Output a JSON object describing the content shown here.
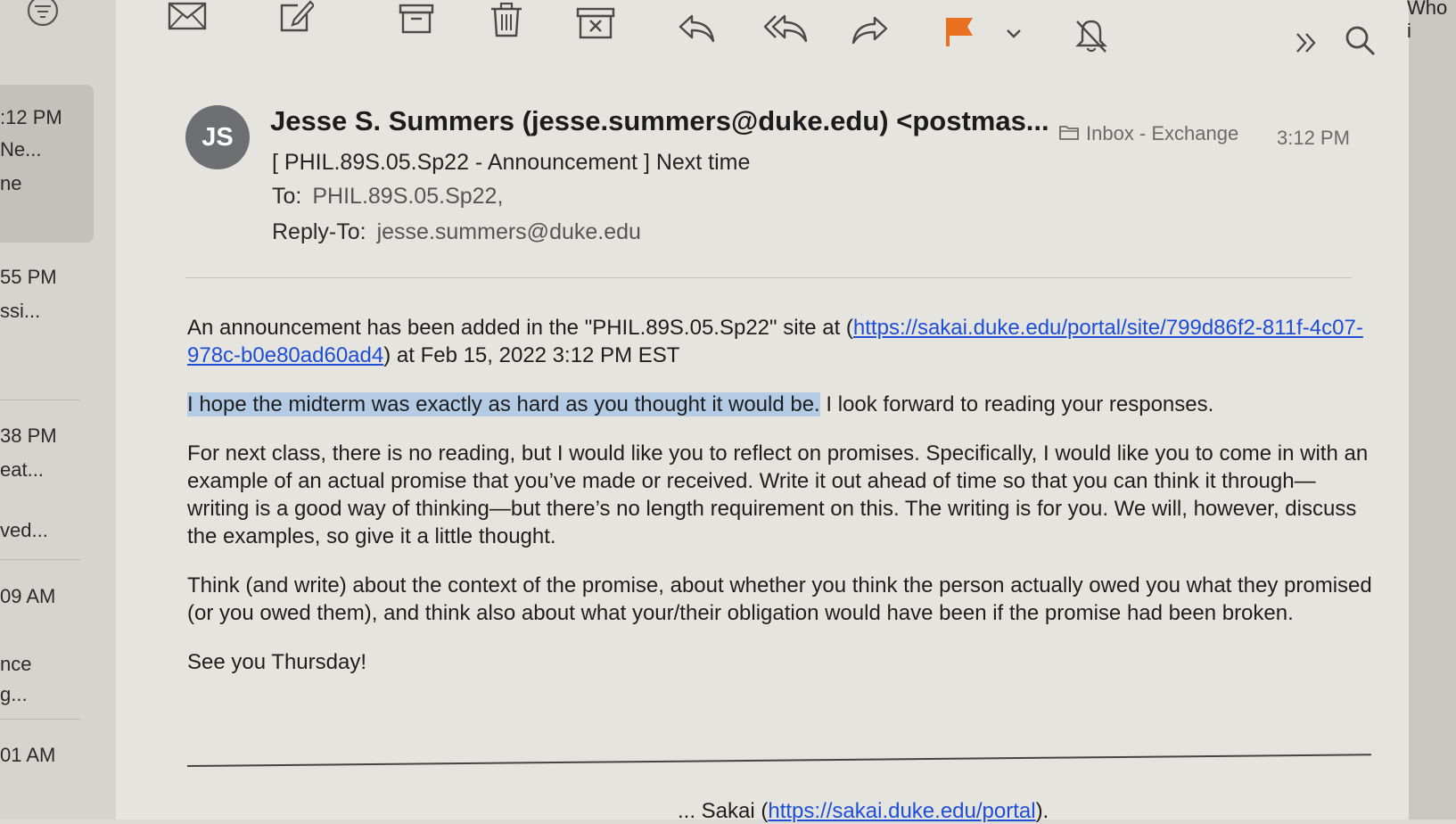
{
  "toolbar": {
    "icons": [
      "filter-icon",
      "mail-icon",
      "compose-icon",
      "archive-icon",
      "trash-icon",
      "junk-icon",
      "reply-icon",
      "reply-all-icon",
      "forward-icon",
      "flag-icon",
      "chevron-down-icon",
      "mute-icon",
      "more-icon",
      "search-icon"
    ],
    "flag_color": "#e8701f"
  },
  "sidebar": {
    "items": [
      {
        "time": ":12 PM",
        "lines": [
          "Ne...",
          "ne"
        ],
        "selected": true
      },
      {
        "time": "55 PM",
        "lines": [
          "ssi..."
        ]
      },
      {
        "time": "38 PM",
        "lines": [
          "eat...",
          "ved..."
        ]
      },
      {
        "time": "09 AM",
        "lines": [
          "nce",
          "g..."
        ]
      },
      {
        "time": "01 AM",
        "lines": []
      }
    ]
  },
  "right_edge_text": "Who i",
  "message": {
    "avatar_initials": "JS",
    "from": "Jesse S. Summers (jesse.summers@duke.edu) <postmas...",
    "folder": "Inbox - Exchange",
    "time": "3:12 PM",
    "subject": "[ PHIL.89S.05.Sp22 -  Announcement ] Next time",
    "to_label": "To:",
    "to_value": "PHIL.89S.05.Sp22,",
    "reply_to_label": "Reply-To:",
    "reply_to_value": "jesse.summers@duke.edu",
    "body": {
      "p1_before": "An announcement has been added in the \"PHIL.89S.05.Sp22\" site at (",
      "p1_link": "https://sakai.duke.edu/portal/site/799d86f2-811f-4c07-978c-b0e80ad60ad4",
      "p1_after": ") at Feb 15, 2022 3:12 PM EST",
      "p2_highlight": "I hope the midterm was exactly as hard as you thought it would be.",
      "p2_rest": " I look forward to reading your responses.",
      "p3": "For next class, there is no reading, but I would like you to reflect on promises. Specifically, I would like you to come in with an example of an actual promise that you’ve made or received. Write it out ahead of time so that you can think it through—writing is a good way of thinking—but there’s no length requirement on this. The writing is for you. We will, however, discuss the examples, so give it a little thought.",
      "p4": "Think (and write) about the context of the promise, about whether you think the person actually owed you what they promised (or you owed them), and think also about what your/their obligation would have been if the promise had been broken.",
      "p5": "See you Thursday!"
    },
    "footer_prefix": "... Sakai (",
    "footer_link": "https://sakai.duke.edu/portal",
    "footer_suffix": ")."
  }
}
